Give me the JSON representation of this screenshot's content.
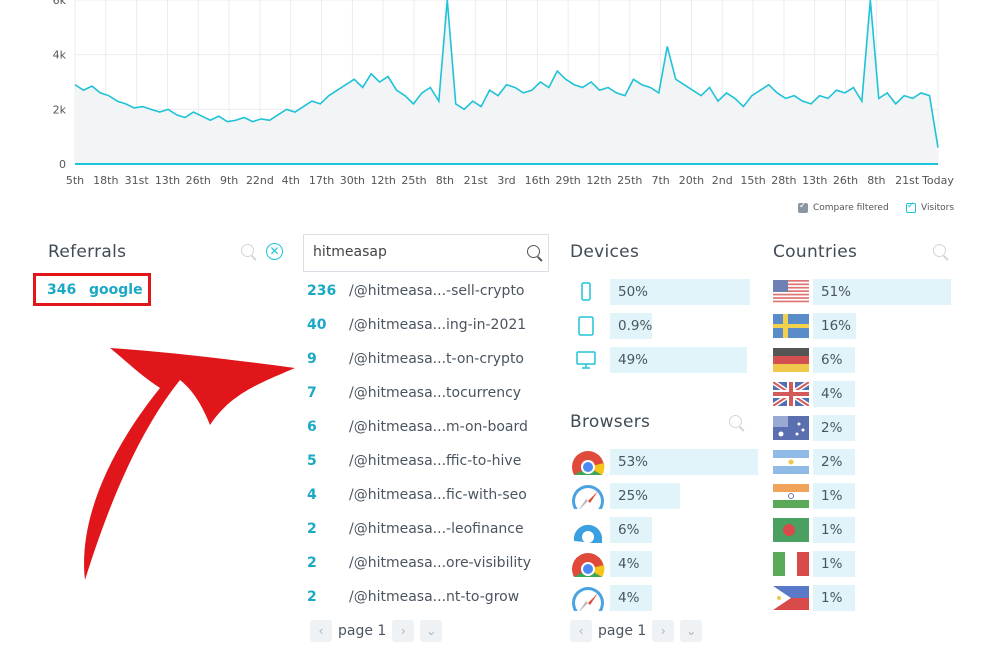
{
  "chart": {
    "y_ticks": [
      "0",
      "2k",
      "4k",
      "6k"
    ],
    "x_ticks": [
      "5th",
      "18th",
      "31st",
      "13th",
      "26th",
      "9th",
      "22nd",
      "4th",
      "17th",
      "30th",
      "12th",
      "25th",
      "8th",
      "21st",
      "3rd",
      "16th",
      "29th",
      "12th",
      "25th",
      "7th",
      "20th",
      "2nd",
      "15th",
      "28th",
      "13th",
      "26th",
      "8th",
      "21st",
      "Today"
    ],
    "colors": {
      "line": "#1ec3d8",
      "fill": "#f2f4f5",
      "grid": "#e9ecef"
    },
    "legend": {
      "compare": "Compare filtered",
      "visitors": "Visitors"
    }
  },
  "chart_data": {
    "type": "area",
    "ylim": [
      0,
      6000
    ],
    "series": [
      {
        "name": "Visitors",
        "values": [
          2900,
          2700,
          2850,
          2600,
          2500,
          2300,
          2200,
          2050,
          2100,
          2000,
          1900,
          2000,
          1800,
          1700,
          1900,
          1750,
          1600,
          1750,
          1550,
          1600,
          1700,
          1550,
          1650,
          1600,
          1800,
          2000,
          1900,
          2100,
          2300,
          2200,
          2500,
          2700,
          2900,
          3100,
          2800,
          3300,
          3000,
          3200,
          2700,
          2500,
          2200,
          2600,
          2800,
          2300,
          6000,
          2200,
          2000,
          2300,
          2100,
          2700,
          2500,
          2900,
          2800,
          2600,
          2700,
          3000,
          2800,
          3400,
          3100,
          2900,
          2800,
          3000,
          2700,
          2800,
          2600,
          2500,
          3100,
          2900,
          2800,
          2600,
          4300,
          3100,
          2900,
          2700,
          2500,
          2800,
          2300,
          2600,
          2400,
          2100,
          2500,
          2700,
          2900,
          2600,
          2400,
          2500,
          2300,
          2200,
          2500,
          2400,
          2700,
          2600,
          2800,
          2300,
          6000,
          2400,
          2600,
          2200,
          2500,
          2400,
          2600,
          2500,
          600
        ]
      }
    ]
  },
  "referrals": {
    "title": "Referrals",
    "items": [
      {
        "count": "346",
        "name": "google"
      }
    ]
  },
  "search": {
    "value": "hitmeasap"
  },
  "paths": [
    {
      "count": "236",
      "path": "/@hitmeasa...-sell-crypto"
    },
    {
      "count": "40",
      "path": "/@hitmeasa...ing-in-2021"
    },
    {
      "count": "9",
      "path": "/@hitmeasa...t-on-crypto"
    },
    {
      "count": "7",
      "path": "/@hitmeasa...tocurrency"
    },
    {
      "count": "6",
      "path": "/@hitmeasa...m-on-board"
    },
    {
      "count": "5",
      "path": "/@hitmeasa...ffic-to-hive"
    },
    {
      "count": "4",
      "path": "/@hitmeasa...fic-with-seo"
    },
    {
      "count": "2",
      "path": "/@hitmeasa...-leofinance"
    },
    {
      "count": "2",
      "path": "/@hitmeasa...ore-visibility"
    },
    {
      "count": "2",
      "path": "/@hitmeasa...nt-to-grow"
    }
  ],
  "paths_pager": {
    "label": "page 1"
  },
  "devices": {
    "title": "Devices",
    "items": [
      {
        "icon": "mobile-icon",
        "pct": "50%",
        "share": 0.5
      },
      {
        "icon": "tablet-icon",
        "pct": "0.9%",
        "share": 0.009
      },
      {
        "icon": "desktop-icon",
        "pct": "49%",
        "share": 0.49
      }
    ]
  },
  "browsers": {
    "title": "Browsers",
    "items": [
      {
        "icon": "chrome-icon",
        "pct": "53%",
        "share": 0.53
      },
      {
        "icon": "safari-icon",
        "pct": "25%",
        "share": 0.25
      },
      {
        "icon": "edge-icon",
        "pct": "6%",
        "share": 0.06
      },
      {
        "icon": "chrome-icon",
        "pct": "4%",
        "share": 0.04
      },
      {
        "icon": "safari-icon",
        "pct": "4%",
        "share": 0.04
      }
    ],
    "pager": {
      "label": "page 1"
    }
  },
  "countries": {
    "title": "Countries",
    "items": [
      {
        "icon": "us-flag-icon",
        "pct": "51%",
        "share": 0.51
      },
      {
        "icon": "sweden-flag-icon",
        "pct": "16%",
        "share": 0.16
      },
      {
        "icon": "germany-flag-icon",
        "pct": "6%",
        "share": 0.06
      },
      {
        "icon": "uk-flag-icon",
        "pct": "4%",
        "share": 0.04
      },
      {
        "icon": "australia-flag-icon",
        "pct": "2%",
        "share": 0.02
      },
      {
        "icon": "argentina-flag-icon",
        "pct": "2%",
        "share": 0.02
      },
      {
        "icon": "india-flag-icon",
        "pct": "1%",
        "share": 0.01
      },
      {
        "icon": "bangladesh-flag-icon",
        "pct": "1%",
        "share": 0.01
      },
      {
        "icon": "italy-flag-icon",
        "pct": "1%",
        "share": 0.01
      },
      {
        "icon": "philippines-flag-icon",
        "pct": "1%",
        "share": 0.01
      }
    ]
  }
}
